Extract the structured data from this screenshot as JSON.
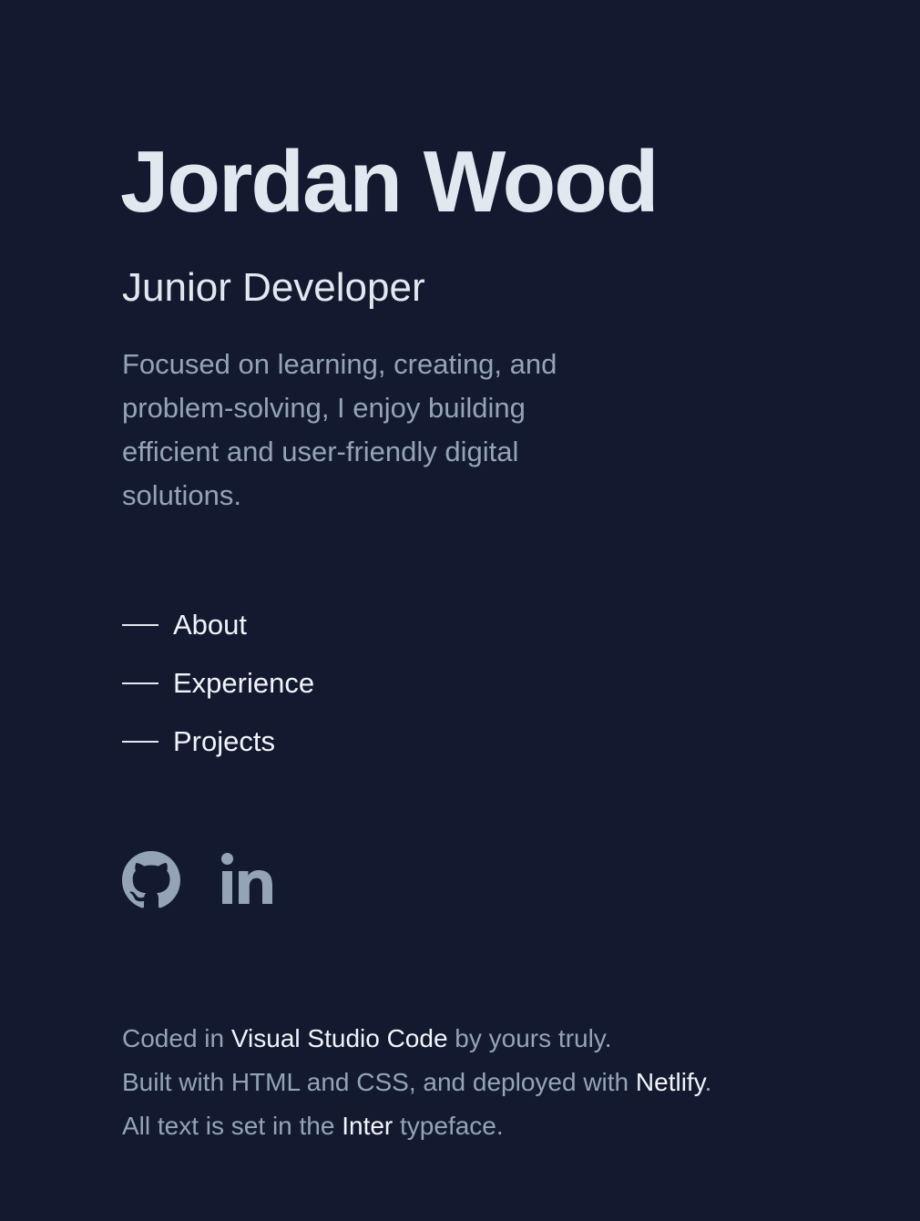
{
  "header": {
    "name": "Jordan Wood",
    "role": "Junior Developer",
    "tagline": "Focused on learning, creating, and problem-solving, I enjoy building efficient and user-friendly digital solutions."
  },
  "nav": {
    "items": [
      {
        "label": "About"
      },
      {
        "label": "Experience"
      },
      {
        "label": "Projects"
      }
    ]
  },
  "social": {
    "icons": [
      "github-icon",
      "linkedin-icon"
    ],
    "icon_color": "#94a3b8"
  },
  "footer": {
    "line1_pre": "Coded in ",
    "line1_link": "Visual Studio Code",
    "line1_post": " by yours truly.",
    "line2_pre": "Built with HTML and CSS, and deployed with ",
    "line2_link": "Netlify",
    "line2_post": ".",
    "line3_pre": "All text is set in the ",
    "line3_link": "Inter",
    "line3_post": " typeface."
  },
  "colors": {
    "background": "#131a2f",
    "heading": "#e2e8f0",
    "muted": "#94a3b8",
    "highlight": "#f1f5f9"
  }
}
